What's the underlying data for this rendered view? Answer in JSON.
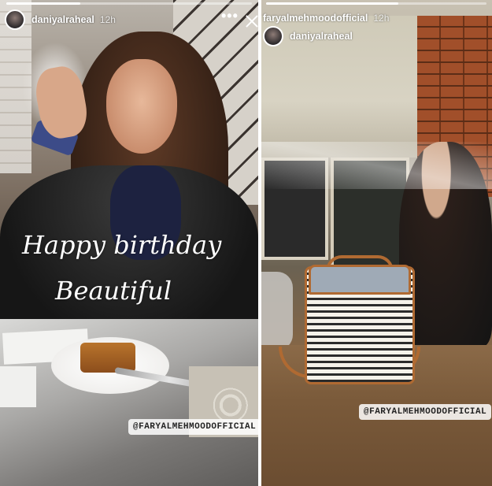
{
  "colors": {
    "overlay_text": "#ffffff",
    "mention_bg": "#ffffff",
    "mention_text": "#222222",
    "divider": "#ffffff"
  },
  "left_story": {
    "username": "daniyalraheal",
    "time": "12h",
    "menu_icon": "ellipsis-icon",
    "close_icon": "close-icon",
    "progress": 0.3,
    "caption_line1": "Happy birthday",
    "caption_line2": "Beautiful",
    "mention": "@FARYALMEHMOODOFFICIAL"
  },
  "right_story": {
    "username": "faryalmehmoodofficial",
    "time": "12h",
    "reposted_from": "daniyalraheal",
    "progress": 0.6,
    "mention": "@FARYALMEHMOODOFFICIAL"
  }
}
